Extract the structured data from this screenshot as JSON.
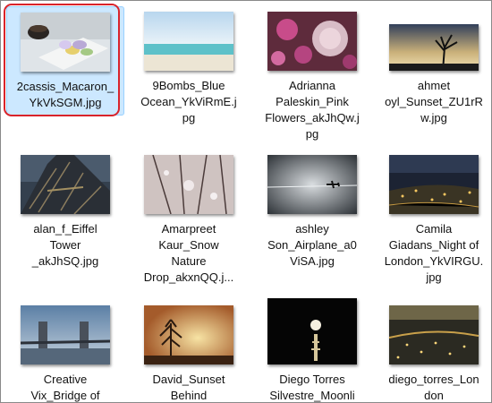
{
  "files": [
    {
      "lines": [
        "2cassis_Macaron_",
        "YkVkSGM.jpg"
      ],
      "selected": true
    },
    {
      "lines": [
        "9Bombs_Blue",
        "Ocean_YkViRmE.j",
        "pg"
      ]
    },
    {
      "lines": [
        "Adrianna",
        "Paleskin_Pink",
        "Flowers_akJhQw.j",
        "pg"
      ]
    },
    {
      "lines": [
        "ahmet",
        "oyl_Sunset_ZU1rR",
        "w.jpg"
      ]
    },
    {
      "lines": [
        "alan_f_Eiffel",
        "Tower",
        "_akJhSQ.jpg"
      ]
    },
    {
      "lines": [
        "Amarpreet",
        "Kaur_Snow",
        "Nature",
        "Drop_akxnQQ.j..."
      ]
    },
    {
      "lines": [
        "ashley",
        "Son_Airplane_a0",
        "ViSA.jpg"
      ]
    },
    {
      "lines": [
        "Camila",
        "Giadans_Night of",
        "London_YkVIRGU.",
        "jpg"
      ]
    },
    {
      "lines": [
        "Creative",
        "Vix_Bridge of"
      ]
    },
    {
      "lines": [
        "David_Sunset",
        "Behind"
      ]
    },
    {
      "lines": [
        "Diego Torres",
        "Silvestre_Moonli"
      ]
    },
    {
      "lines": [
        "diego_torres_Lon",
        "don"
      ]
    }
  ]
}
